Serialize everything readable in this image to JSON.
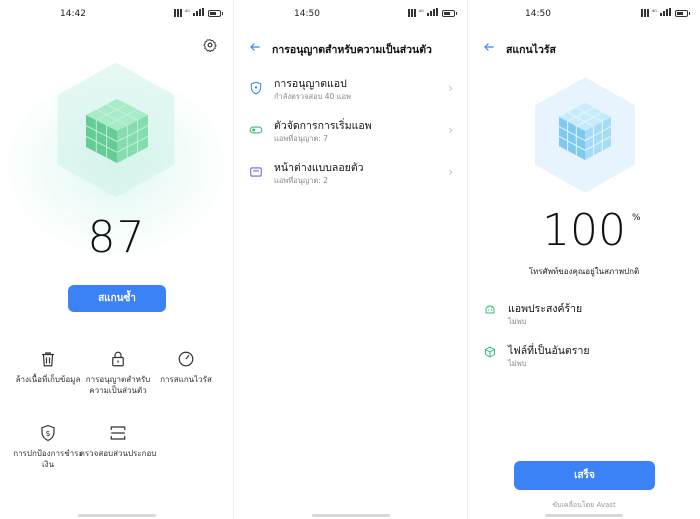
{
  "panel1": {
    "time": "14:42",
    "score": "87",
    "scan_again": "สแกนซ้ำ",
    "tools": [
      {
        "label": "ล้างเนื้อที่เก็บข้อมูล",
        "icon": "trash-icon"
      },
      {
        "label": "การอนุญาตสำหรับความเป็นส่วนตัว",
        "icon": "lock-icon"
      },
      {
        "label": "การสแกนไวรัส",
        "icon": "gauge-icon"
      },
      {
        "label": "การปกป้องการชำระเงิน",
        "icon": "shield-dollar-icon"
      },
      {
        "label": "ตรวจสอบส่วนประกอบ",
        "icon": "scan-frame-icon"
      }
    ]
  },
  "panel2": {
    "time": "14:50",
    "title": "การอนุญาตสำหรับความเป็นส่วนตัว",
    "items": [
      {
        "title": "การอนุญาตแอป",
        "sub": "กำลังตรวจสอบ 40 แอพ",
        "icon": "shield-icon"
      },
      {
        "title": "ตัวจัดการการเริ่มแอพ",
        "sub": "แอพที่อนุญาต: 7",
        "icon": "toggle-icon"
      },
      {
        "title": "หน้าต่างแบบลอยตัว",
        "sub": "แอพที่อนุญาต: 2",
        "icon": "floating-window-icon"
      }
    ]
  },
  "panel3": {
    "time": "14:50",
    "title": "สแกนไวรัส",
    "percent": "100",
    "percent_sign": "%",
    "safe_text": "โทรศัพท์ของคุณอยู่ในสภาพปกติ",
    "results": [
      {
        "title": "แอพประสงค์ร้าย",
        "sub": "ไม่พบ",
        "icon": "android-icon"
      },
      {
        "title": "ไฟล์ที่เป็นอันตราย",
        "sub": "ไม่พบ",
        "icon": "box-icon"
      }
    ],
    "done": "เสร็จ",
    "powered": "ขับเคลื่อนโดย Avast"
  },
  "colors": {
    "accent": "#3b82f6",
    "green": "#2fbf71",
    "cube_green": "#7fd9a8",
    "cube_blue": "#8fd3f4"
  }
}
